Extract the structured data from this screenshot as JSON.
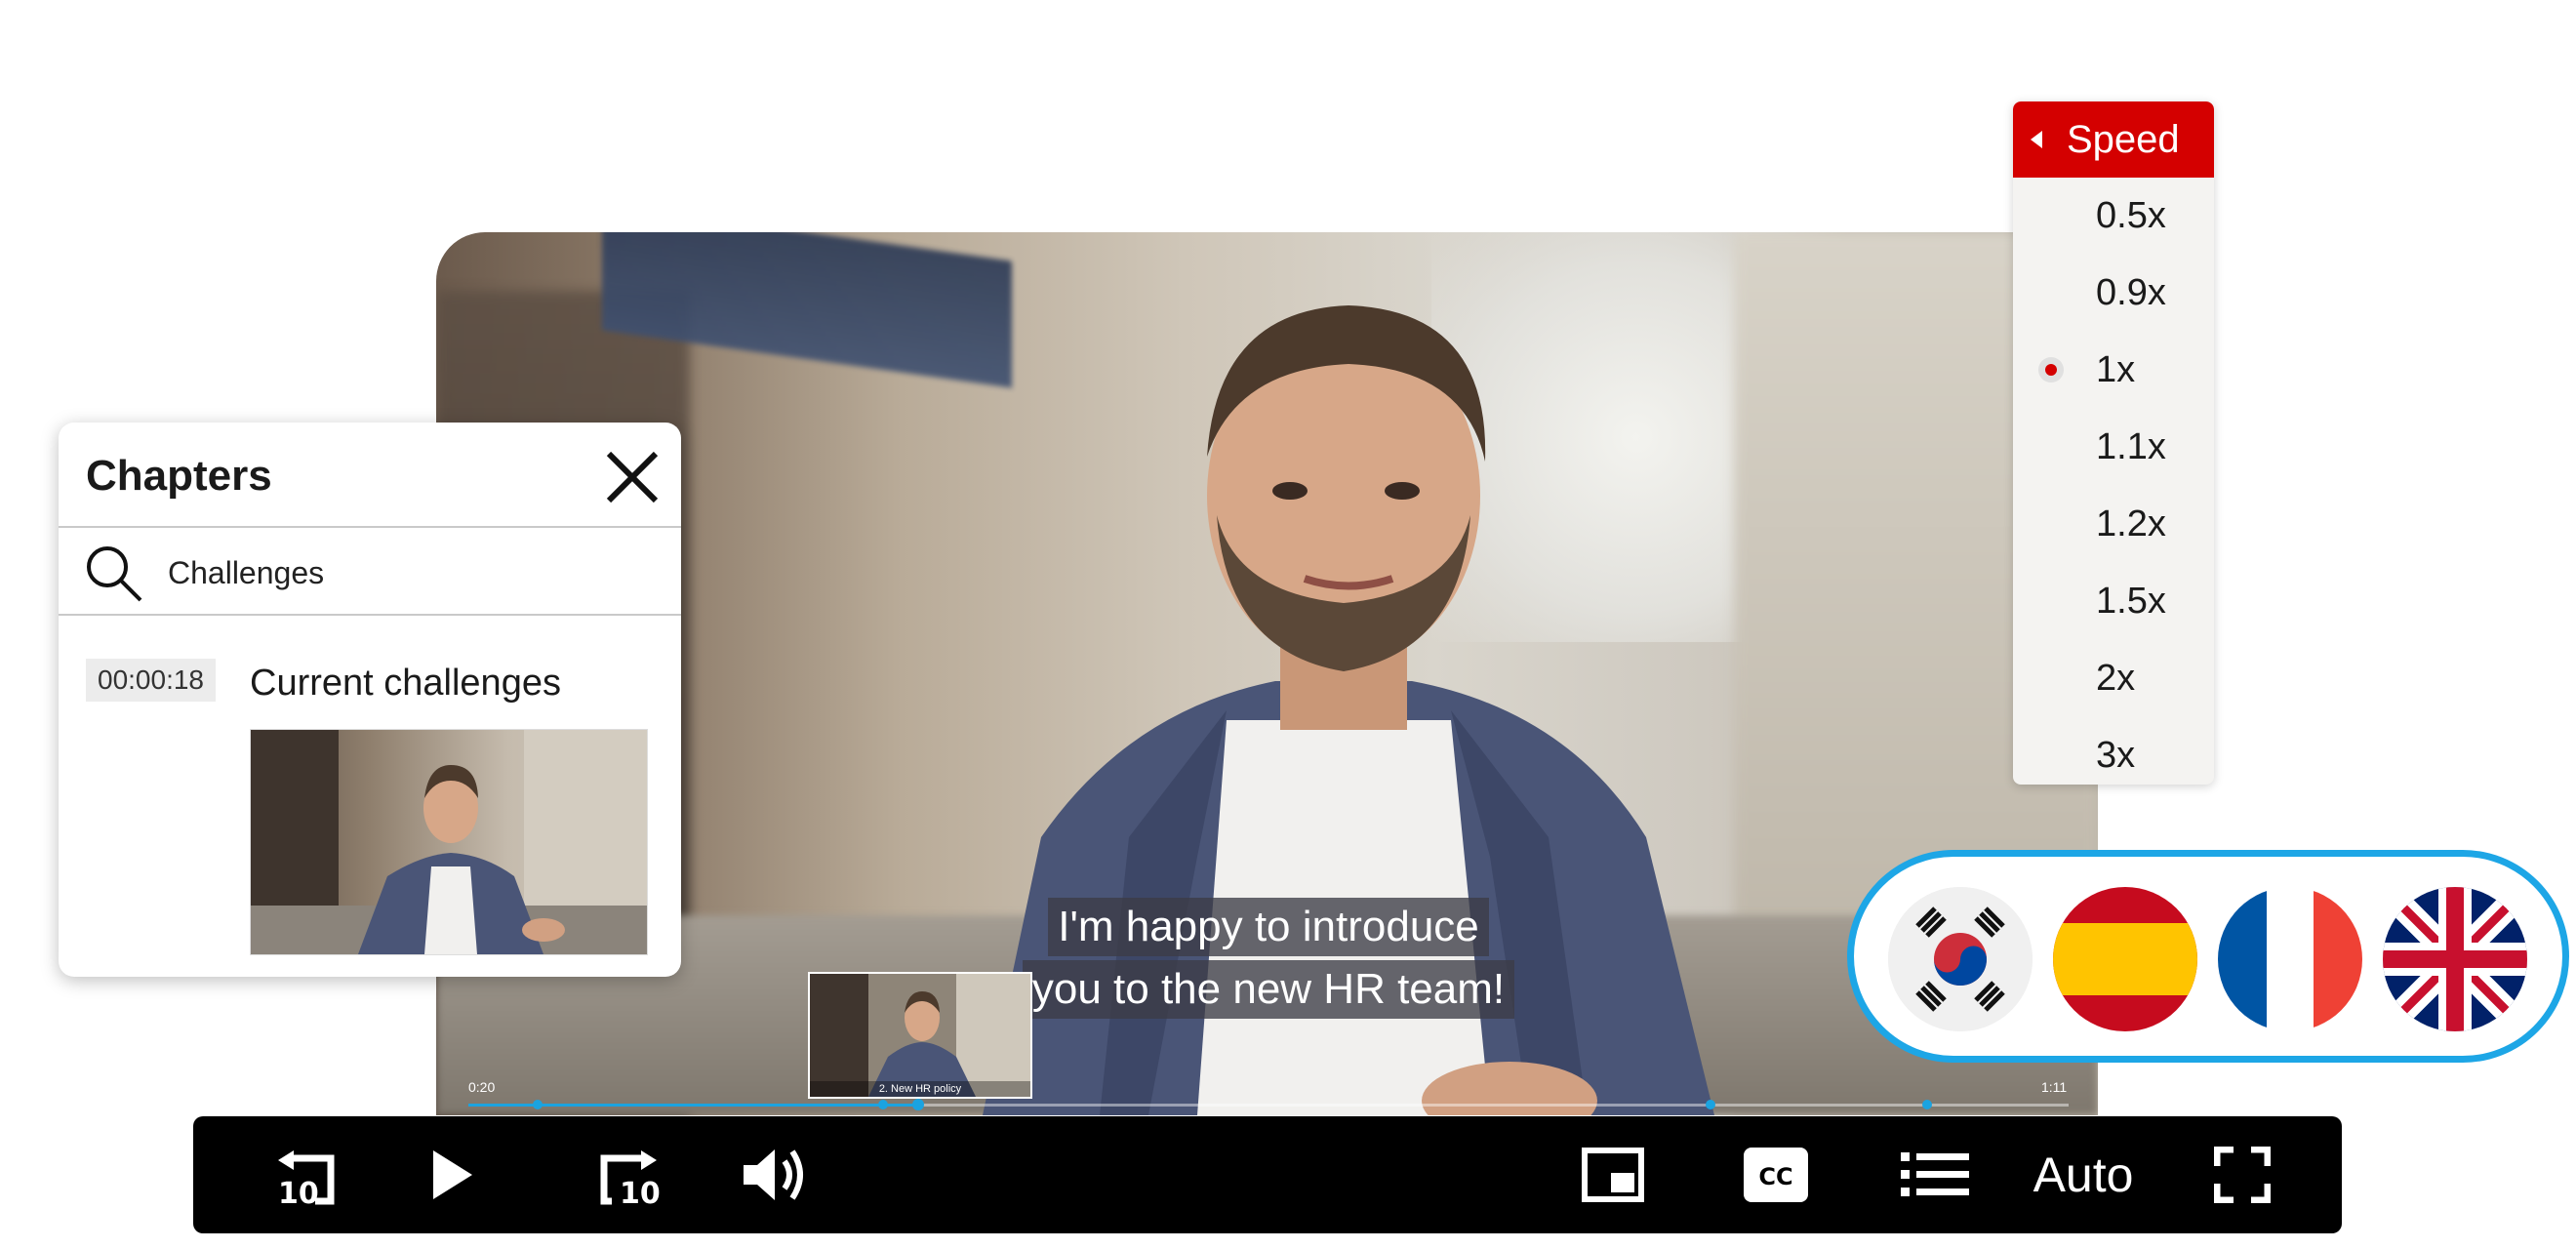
{
  "chapters": {
    "title": "Chapters",
    "search_query": "Challenges",
    "items": [
      {
        "timestamp": "00:00:18",
        "title": "Current challenges"
      }
    ]
  },
  "subtitle": {
    "lines": [
      "I'm happy to introduce",
      "you to the new HR team!"
    ]
  },
  "scrubber": {
    "current_time": "0:20",
    "end_time": "1:11",
    "preview_caption": "2. New HR policy"
  },
  "speed_menu": {
    "header": "Speed",
    "options": [
      "0.5x",
      "0.9x",
      "1x",
      "1.1x",
      "1.2x",
      "1.5x",
      "2x",
      "3x"
    ],
    "selected": "1x"
  },
  "controls": {
    "quality_label": "Auto",
    "icons": [
      "rewind-10-icon",
      "play-icon",
      "forward-10-icon",
      "volume-icon",
      "picture-in-picture-icon",
      "closed-captions-icon",
      "chapters-list-icon",
      "fullscreen-icon"
    ],
    "rewind_amount": "10",
    "forward_amount": "10",
    "cc_label": "CC"
  },
  "languages": {
    "flags": [
      "korea-flag-icon",
      "spain-flag-icon",
      "france-flag-icon",
      "uk-flag-icon"
    ]
  },
  "colors": {
    "accent_blue": "#1da6e6",
    "speed_red": "#d40000",
    "control_bar": "#000000"
  }
}
